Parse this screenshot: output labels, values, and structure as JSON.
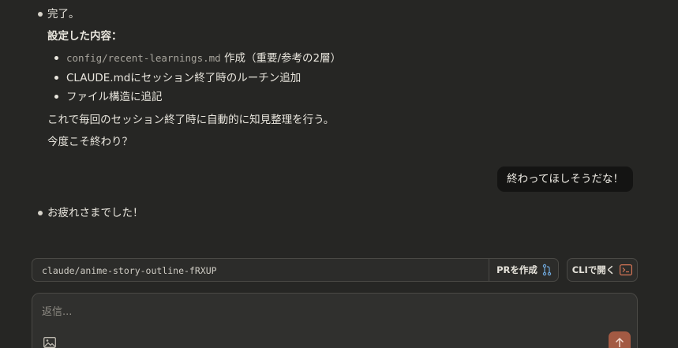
{
  "conversation": {
    "assistant_message_1": {
      "lead": "完了。",
      "heading": "設定した内容：",
      "items": [
        {
          "code": "config/recent-learnings.md",
          "text": " 作成（重要/参考の2層）"
        },
        {
          "text": "CLAUDE.mdにセッション終了時のルーチン追加"
        },
        {
          "text": "ファイル構造に追記"
        }
      ],
      "summary": "これで毎回のセッション終了時に自動的に知見整理を行う。",
      "question": "今度こそ終わり？"
    },
    "user_message": "終わってほしそうだな！",
    "assistant_message_2": "お疲れさまでした！"
  },
  "toolbar": {
    "branch_name": "claude/anime-story-outline-fRXUP",
    "pr_label": "PRを作成",
    "cli_label": "CLIで開く"
  },
  "composer": {
    "placeholder": "返信..."
  },
  "icons": {
    "pr": "git-pull-request-icon",
    "cli": "terminal-icon",
    "attach": "image-icon",
    "send": "arrow-up-icon"
  },
  "colors": {
    "background": "#262624",
    "user_bubble": "#141413",
    "accent_send": "#a35a43",
    "pr_icon": "#6fa8dc",
    "cli_icon": "#d97757"
  }
}
